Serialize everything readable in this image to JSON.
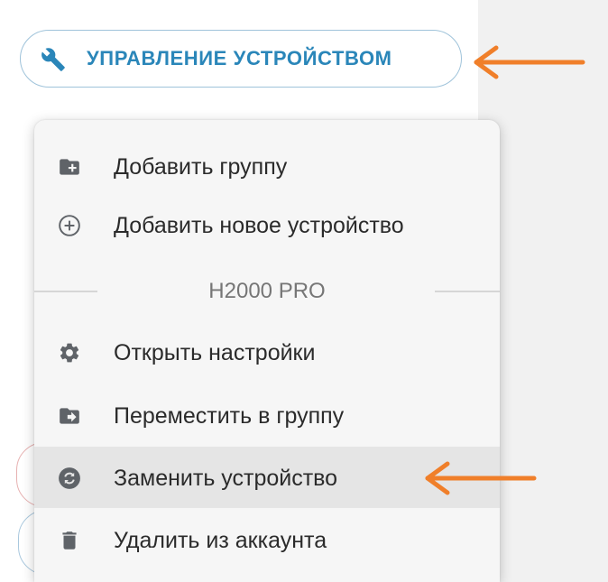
{
  "manage_button": {
    "label": "УПРАВЛЕНИЕ УСТРОЙСТВОМ",
    "icon": "wrench-icon",
    "color": "#2a86b9"
  },
  "menu": {
    "items": [
      {
        "label": "Добавить группу",
        "icon": "add-folder-icon"
      },
      {
        "label": "Добавить новое устройство",
        "icon": "plus-circle-icon"
      }
    ],
    "section_title": "H2000 PRO",
    "device_items": [
      {
        "label": "Открыть настройки",
        "icon": "gear-icon"
      },
      {
        "label": "Переместить в группу",
        "icon": "move-folder-icon"
      },
      {
        "label": "Заменить устройство",
        "icon": "replace-icon",
        "highlighted": true
      },
      {
        "label": "Удалить из аккаунта",
        "icon": "trash-icon"
      }
    ]
  },
  "annotations": {
    "arrow_color": "#f07f2a"
  }
}
